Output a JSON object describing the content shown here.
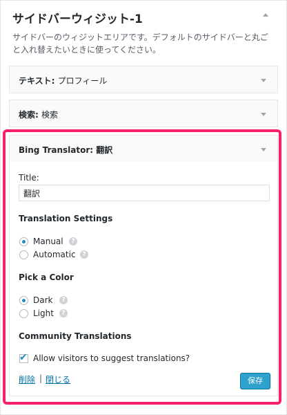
{
  "sidebar": {
    "title": "サイドバーウィジット-1",
    "description": "サイドバーのウィジットエリアです。デフォルトのサイドバーと丸ごと入れ替えたいときに使ってください。"
  },
  "widgets": [
    {
      "type": "テキスト",
      "sep": ": ",
      "name": "プロフィール"
    },
    {
      "type": "検索",
      "sep": ": ",
      "name": "検索"
    }
  ],
  "bing_widget": {
    "header": "Bing Translator: 翻訳",
    "title_label": "Title:",
    "title_value": "翻訳",
    "translation_settings_label": "Translation Settings",
    "opt_manual": "Manual",
    "opt_automatic": "Automatic",
    "selected_translation": "Manual",
    "pick_color_label": "Pick a Color",
    "opt_dark": "Dark",
    "opt_light": "Light",
    "selected_color": "Dark",
    "community_label": "Community Translations",
    "allow_label": "Allow visitors to suggest translations?",
    "allow_checked": true,
    "delete_link": "削除",
    "separator": "|",
    "close_link": "閉じる",
    "save_button": "保存"
  },
  "icons": {
    "help": "?",
    "checkmark": "✔"
  },
  "colors": {
    "highlight": "#ff1e6e",
    "accent": "#2ea2cc",
    "link": "#0073aa"
  }
}
